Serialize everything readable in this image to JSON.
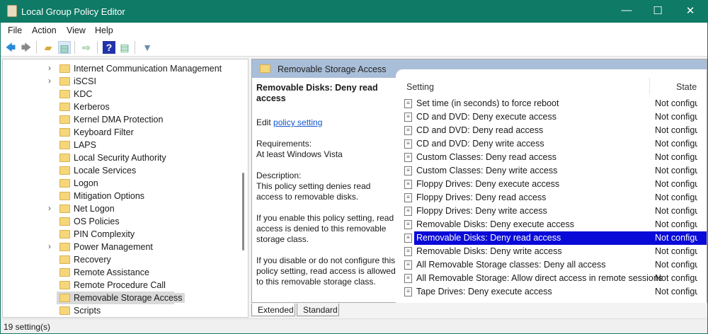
{
  "window": {
    "title": "Local Group Policy Editor",
    "minimize": "—",
    "maximize": "☐",
    "close": "✕"
  },
  "menu": [
    "File",
    "Action",
    "View",
    "Help"
  ],
  "toolbar": {
    "icons": [
      "back-arrow-icon",
      "forward-arrow-icon",
      "up-folder-icon",
      "show-hide-tree-icon",
      "export-list-icon",
      "help-icon",
      "properties-icon",
      "filter-icon"
    ]
  },
  "tree": {
    "items": [
      {
        "label": "Internet Communication Management",
        "expandable": true
      },
      {
        "label": "iSCSI",
        "expandable": true
      },
      {
        "label": "KDC",
        "expandable": false
      },
      {
        "label": "Kerberos",
        "expandable": false
      },
      {
        "label": "Kernel DMA Protection",
        "expandable": false
      },
      {
        "label": "Keyboard Filter",
        "expandable": false
      },
      {
        "label": "LAPS",
        "expandable": false
      },
      {
        "label": "Local Security Authority",
        "expandable": false
      },
      {
        "label": "Locale Services",
        "expandable": false
      },
      {
        "label": "Logon",
        "expandable": false
      },
      {
        "label": "Mitigation Options",
        "expandable": false
      },
      {
        "label": "Net Logon",
        "expandable": true
      },
      {
        "label": "OS Policies",
        "expandable": false
      },
      {
        "label": "PIN Complexity",
        "expandable": false
      },
      {
        "label": "Power Management",
        "expandable": true
      },
      {
        "label": "Recovery",
        "expandable": false
      },
      {
        "label": "Remote Assistance",
        "expandable": false
      },
      {
        "label": "Remote Procedure Call",
        "expandable": false
      },
      {
        "label": "Removable Storage Access",
        "expandable": false,
        "selected": true
      },
      {
        "label": "Scripts",
        "expandable": false
      }
    ]
  },
  "pane": {
    "header": "Removable Storage Access",
    "description": {
      "title": "Removable Disks: Deny read access",
      "edit_prefix": "Edit",
      "edit_link": "policy setting",
      "req_label": "Requirements:",
      "req_value": "At least Windows Vista",
      "desc_label": "Description:",
      "desc_text": "This policy setting denies read access to removable disks.",
      "enable_text": "If you enable this policy setting, read access is denied to this removable storage class.",
      "disable_text": "If you disable or do not configure this policy setting, read access is allowed to this removable storage class."
    },
    "columns": {
      "setting": "Setting",
      "state": "State"
    },
    "rows": [
      {
        "name": "Set time (in seconds) to force reboot",
        "state": "Not configured"
      },
      {
        "name": "CD and DVD: Deny execute access",
        "state": "Not configured"
      },
      {
        "name": "CD and DVD: Deny read access",
        "state": "Not configured"
      },
      {
        "name": "CD and DVD: Deny write access",
        "state": "Not configured"
      },
      {
        "name": "Custom Classes: Deny read access",
        "state": "Not configured"
      },
      {
        "name": "Custom Classes: Deny write access",
        "state": "Not configured"
      },
      {
        "name": "Floppy Drives: Deny execute access",
        "state": "Not configured"
      },
      {
        "name": "Floppy Drives: Deny read access",
        "state": "Not configured"
      },
      {
        "name": "Floppy Drives: Deny write access",
        "state": "Not configured"
      },
      {
        "name": "Removable Disks: Deny execute access",
        "state": "Not configured"
      },
      {
        "name": "Removable Disks: Deny read access",
        "state": "Not configured",
        "selected": true
      },
      {
        "name": "Removable Disks: Deny write access",
        "state": "Not configured"
      },
      {
        "name": "All Removable Storage classes: Deny all access",
        "state": "Not configured"
      },
      {
        "name": "All Removable Storage: Allow direct access in remote sessions",
        "state": "Not configured"
      },
      {
        "name": "Tape Drives: Deny execute access",
        "state": "Not configured"
      }
    ],
    "tabs": [
      "Extended",
      "Standard"
    ],
    "active_tab": "Extended"
  },
  "status": "19 setting(s)",
  "colors": {
    "titlebar": "#0f7a66",
    "selection": "#0a0ad8",
    "header": "#a9bed8"
  }
}
